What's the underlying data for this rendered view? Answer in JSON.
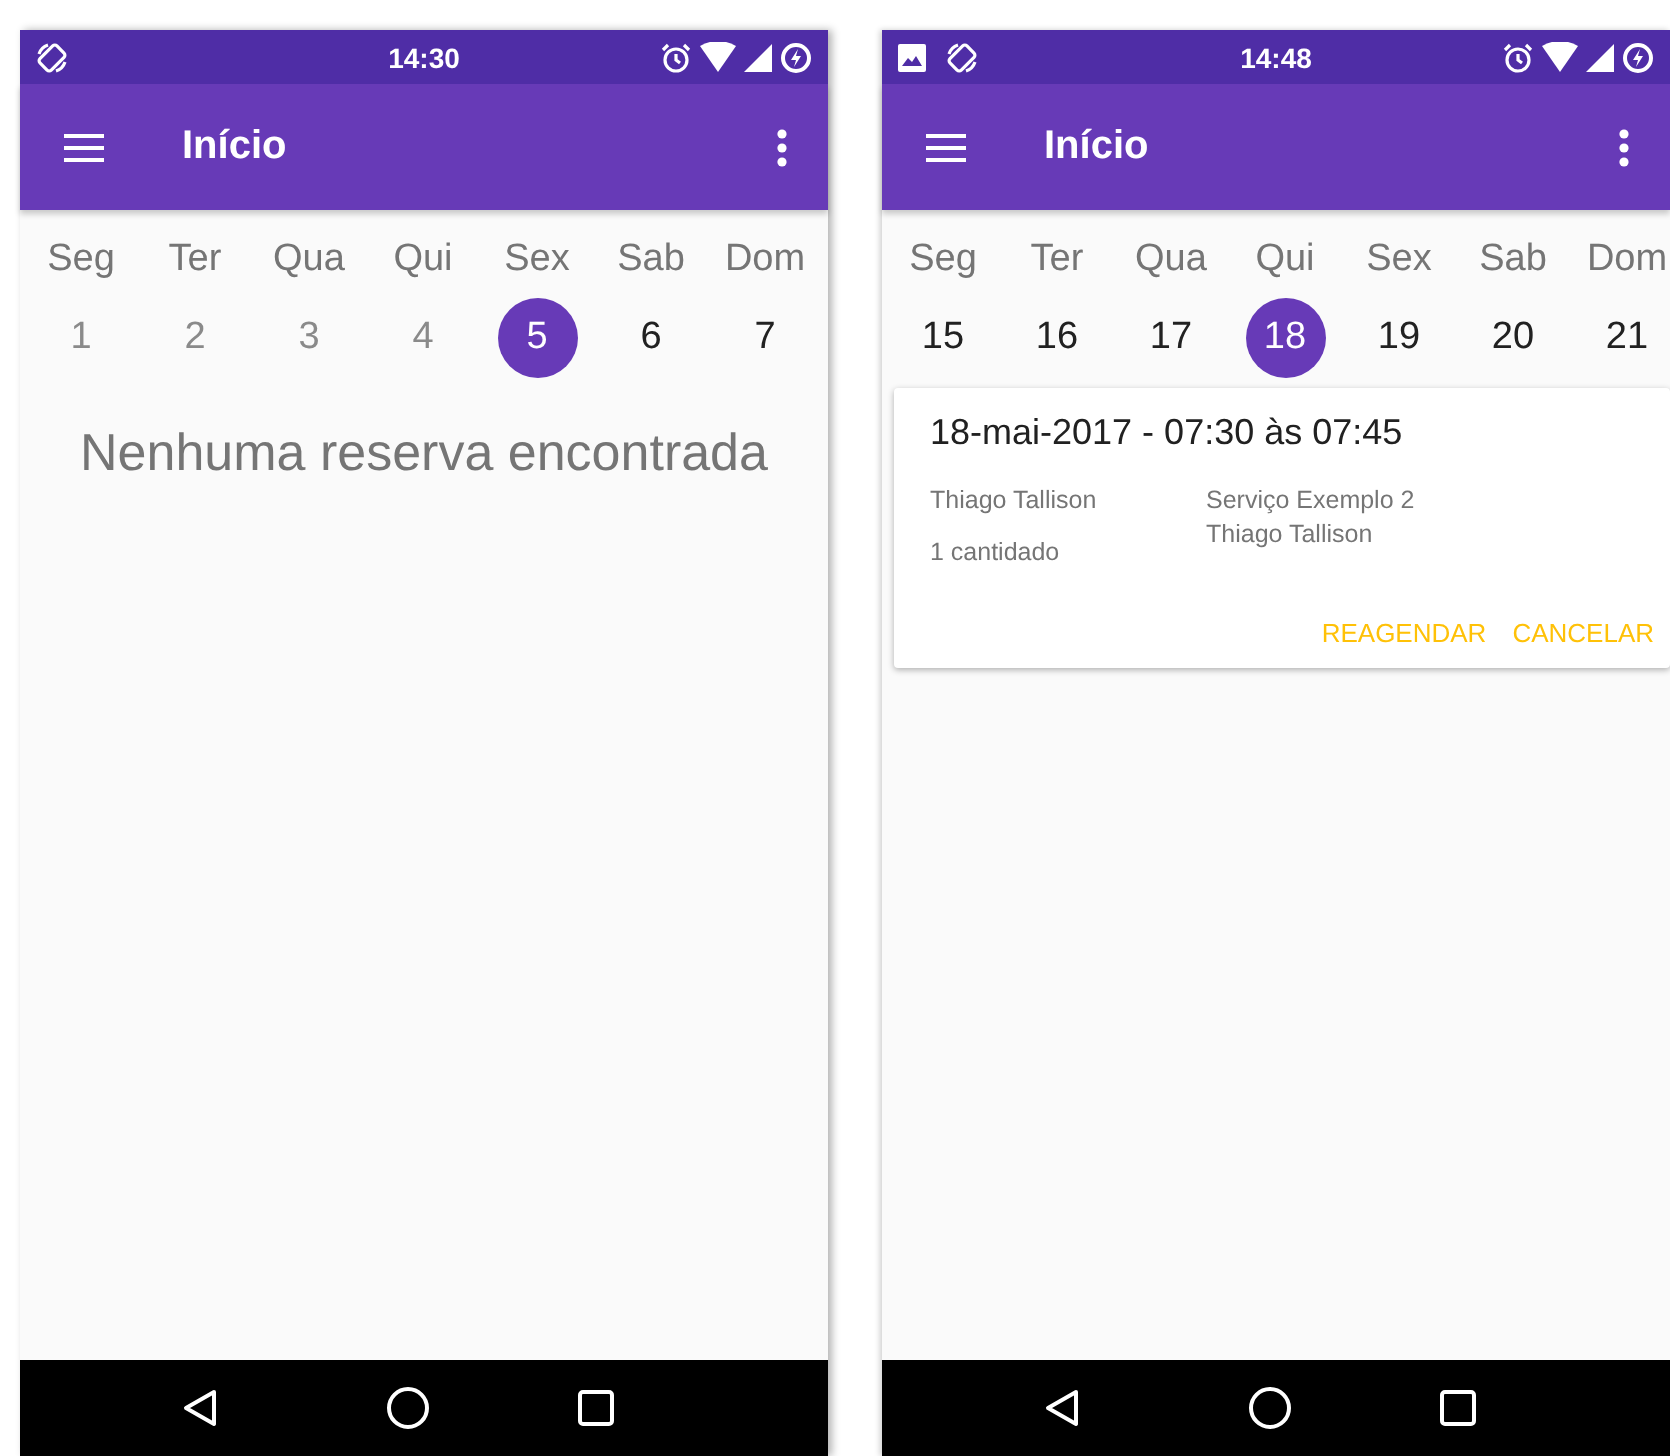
{
  "phones": [
    {
      "status_bar": {
        "time": "14:30",
        "notifications": [
          {
            "kind": "rotate"
          }
        ]
      },
      "app_bar": {
        "title": "Início"
      },
      "week": {
        "days": [
          {
            "weekday": "Seg",
            "date": "1",
            "selected": false,
            "past": true
          },
          {
            "weekday": "Ter",
            "date": "2",
            "selected": false,
            "past": true
          },
          {
            "weekday": "Qua",
            "date": "3",
            "selected": false,
            "past": true
          },
          {
            "weekday": "Qui",
            "date": "4",
            "selected": false,
            "past": true
          },
          {
            "weekday": "Sex",
            "date": "5",
            "selected": true,
            "past": false
          },
          {
            "weekday": "Sab",
            "date": "6",
            "selected": false,
            "past": false
          },
          {
            "weekday": "Dom",
            "date": "7",
            "selected": false,
            "past": false
          }
        ]
      },
      "empty_message": "Nenhuma reserva encontrada"
    },
    {
      "status_bar": {
        "time": "14:48",
        "notifications": [
          {
            "kind": "image"
          },
          {
            "kind": "rotate"
          }
        ]
      },
      "app_bar": {
        "title": "Início"
      },
      "week": {
        "days": [
          {
            "weekday": "Seg",
            "date": "15",
            "selected": false,
            "past": false
          },
          {
            "weekday": "Ter",
            "date": "16",
            "selected": false,
            "past": false
          },
          {
            "weekday": "Qua",
            "date": "17",
            "selected": false,
            "past": false
          },
          {
            "weekday": "Qui",
            "date": "18",
            "selected": true,
            "past": false
          },
          {
            "weekday": "Sex",
            "date": "19",
            "selected": false,
            "past": false
          },
          {
            "weekday": "Sab",
            "date": "20",
            "selected": false,
            "past": false
          },
          {
            "weekday": "Dom",
            "date": "21",
            "selected": false,
            "past": false
          }
        ]
      },
      "bookings": [
        {
          "title": "18-mai-2017 - 07:30 às 07:45",
          "client": "Thiago Tallison",
          "quantity": "1 cantidado",
          "service": "Serviço Exemplo 2",
          "professional": "Thiago Tallison",
          "actions": [
            "REAGENDAR",
            "CANCELAR"
          ]
        }
      ]
    }
  ]
}
